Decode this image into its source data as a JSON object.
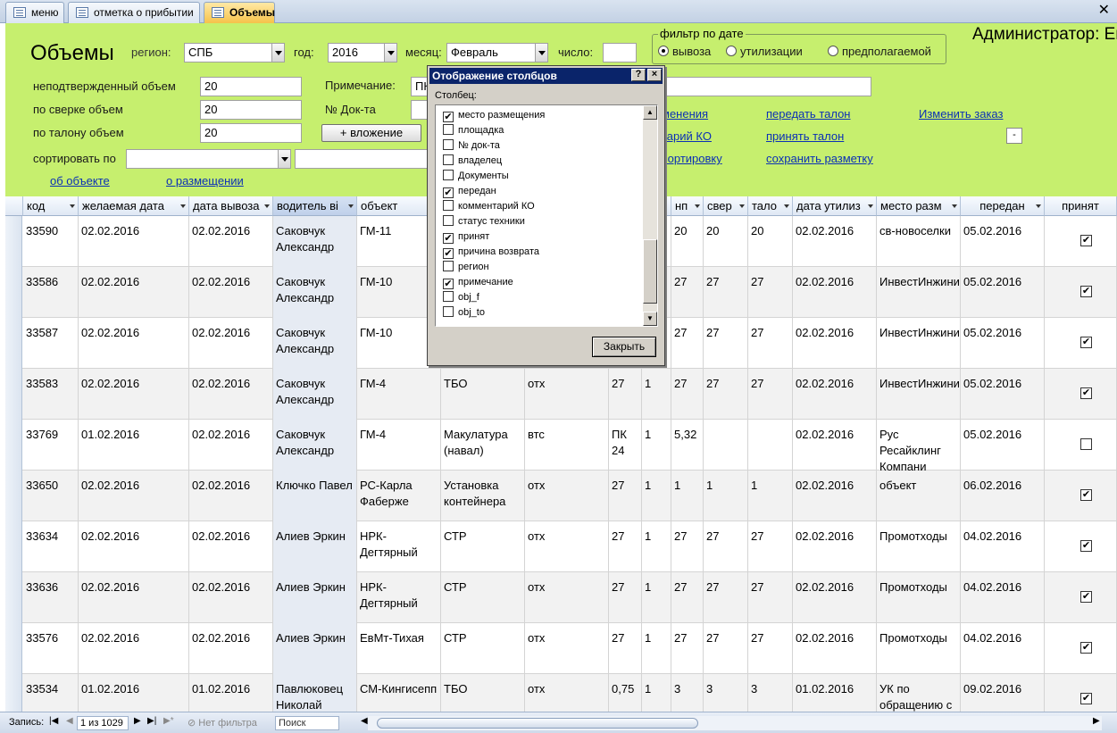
{
  "tabs": [
    {
      "label": "меню"
    },
    {
      "label": "отметка о прибытии"
    },
    {
      "label": "Объемы"
    }
  ],
  "header": {
    "title": "Объемы",
    "region_label": "регион:",
    "region_value": "СПБ",
    "year_label": "год:",
    "year_value": "2016",
    "month_label": "месяц:",
    "month_value": "Февраль",
    "day_label": "число:",
    "day_value": "",
    "admin_text": "Администратор: Ек",
    "date_filter": {
      "legend": "фильтр по дате",
      "options": [
        "вывоза",
        "утилизации",
        "предполагаемой"
      ],
      "selected": "вывоза"
    },
    "unconfirmed_label": "неподтвержденный объем",
    "unconfirmed_value": "20",
    "reconciled_label": "по сверке объем",
    "reconciled_value": "20",
    "ticket_label": "по талону объем",
    "ticket_value": "20",
    "note_label": "Примечание:",
    "note_value": "ПК",
    "doc_label": "№ Док-та",
    "doc_value": "",
    "attach_button": "+ вложение",
    "sort_label": "сортировать по",
    "sort_value": "",
    "sort_value2": "",
    "small_button": "-",
    "links": {
      "changes": "менения",
      "comment_ko": "тарий КО",
      "sort": "сортировку",
      "pass_ticket": "передать талон",
      "accept_ticket": "принять талон",
      "save_layout": "сохранить разметку",
      "change_order": "Изменить заказ",
      "about_object": "об объекте",
      "about_placement": "о размещении"
    }
  },
  "grid": {
    "columns": [
      "код",
      "желаемая дата",
      "дата вывоза",
      "водитель ві",
      "объект",
      "",
      "",
      "",
      "",
      "нп",
      "свер",
      "тало",
      "дата утилиз",
      "место разм",
      "передан",
      "принят"
    ],
    "rows": [
      {
        "kod": "33590",
        "want": "02.02.2016",
        "out": "02.02.2016",
        "driver": "Саковчук Александр",
        "obj": "ГМ-11",
        "waste": "",
        "type": "",
        "c1": "",
        "c2": "",
        "np": "20",
        "sver": "20",
        "talon": "20",
        "util": "02.02.2016",
        "place": "св-новоселки",
        "passed": "05.02.2016",
        "accepted": true
      },
      {
        "kod": "33586",
        "want": "02.02.2016",
        "out": "02.02.2016",
        "driver": "Саковчук Александр",
        "obj": "ГМ-10",
        "waste": "",
        "type": "",
        "c1": "",
        "c2": "",
        "np": "27",
        "sver": "27",
        "talon": "27",
        "util": "02.02.2016",
        "place": "ИнвестИнжиниринг",
        "passed": "05.02.2016",
        "accepted": true
      },
      {
        "kod": "33587",
        "want": "02.02.2016",
        "out": "02.02.2016",
        "driver": "Саковчук Александр",
        "obj": "ГМ-10",
        "waste": "",
        "type": "",
        "c1": "",
        "c2": "",
        "np": "27",
        "sver": "27",
        "talon": "27",
        "util": "02.02.2016",
        "place": "ИнвестИнжиниринг",
        "passed": "05.02.2016",
        "accepted": true
      },
      {
        "kod": "33583",
        "want": "02.02.2016",
        "out": "02.02.2016",
        "driver": "Саковчук Александр",
        "obj": "ГМ-4",
        "waste": "ТБО",
        "type": "отх",
        "c1": "27",
        "c2": "1",
        "np": "27",
        "sver": "27",
        "talon": "27",
        "util": "02.02.2016",
        "place": "ИнвестИнжиниринг",
        "passed": "05.02.2016",
        "accepted": true
      },
      {
        "kod": "33769",
        "want": "01.02.2016",
        "out": "02.02.2016",
        "driver": "Саковчук Александр",
        "obj": "ГМ-4",
        "waste": "Макулатура (навал)",
        "type": "втс",
        "c1": "ПК 24",
        "c2": "1",
        "np": "5,32",
        "sver": "",
        "talon": "",
        "util": "02.02.2016",
        "place": "Рус Ресайклинг Компани",
        "passed": "05.02.2016",
        "accepted": false
      },
      {
        "kod": "33650",
        "want": "02.02.2016",
        "out": "02.02.2016",
        "driver": "Ключко Павел",
        "obj": "РС-Карла Фаберже",
        "waste": "Установка контейнера",
        "type": "отх",
        "c1": "27",
        "c2": "1",
        "np": "1",
        "sver": "1",
        "talon": "1",
        "util": "02.02.2016",
        "place": "объект",
        "passed": "06.02.2016",
        "accepted": true
      },
      {
        "kod": "33634",
        "want": "02.02.2016",
        "out": "02.02.2016",
        "driver": "Алиев Эркин",
        "obj": "НРК-Дегтярный",
        "waste": "СТР",
        "type": "отх",
        "c1": "27",
        "c2": "1",
        "np": "27",
        "sver": "27",
        "talon": "27",
        "util": "02.02.2016",
        "place": "Промотходы",
        "passed": "04.02.2016",
        "accepted": true
      },
      {
        "kod": "33636",
        "want": "02.02.2016",
        "out": "02.02.2016",
        "driver": "Алиев Эркин",
        "obj": "НРК-Дегтярный",
        "waste": "СТР",
        "type": "отх",
        "c1": "27",
        "c2": "1",
        "np": "27",
        "sver": "27",
        "talon": "27",
        "util": "02.02.2016",
        "place": "Промотходы",
        "passed": "04.02.2016",
        "accepted": true
      },
      {
        "kod": "33576",
        "want": "02.02.2016",
        "out": "02.02.2016",
        "driver": "Алиев Эркин",
        "obj": "ЕвМт-Тихая",
        "waste": "СТР",
        "type": "отх",
        "c1": "27",
        "c2": "1",
        "np": "27",
        "sver": "27",
        "talon": "27",
        "util": "02.02.2016",
        "place": "Промотходы",
        "passed": "04.02.2016",
        "accepted": true
      },
      {
        "kod": "33534",
        "want": "01.02.2016",
        "out": "01.02.2016",
        "driver": "Павлюковец Николай",
        "obj": "СМ-Кингисепп",
        "waste": "ТБО",
        "type": "отх",
        "c1": "0,75",
        "c2": "1",
        "np": "3",
        "sver": "3",
        "talon": "3",
        "util": "01.02.2016",
        "place": "УК по обращению с",
        "passed": "09.02.2016",
        "accepted": true
      }
    ]
  },
  "status": {
    "record_label": "Запись:",
    "record_value": "1 из 1029",
    "filter_label": "Нет фильтра",
    "search_placeholder": "Поиск"
  },
  "dialog": {
    "title": "Отображение столбцов",
    "help_btn": "?",
    "close_btn": "×",
    "list_label": "Столбец:",
    "items": [
      {
        "label": "место размещения",
        "checked": true
      },
      {
        "label": "площадка",
        "checked": false
      },
      {
        "label": "№ док-та",
        "checked": false
      },
      {
        "label": "владелец",
        "checked": false
      },
      {
        "label": "Документы",
        "checked": false
      },
      {
        "label": "передан",
        "checked": true
      },
      {
        "label": "комментарий КО",
        "checked": false
      },
      {
        "label": "статус техники",
        "checked": false
      },
      {
        "label": "принят",
        "checked": true
      },
      {
        "label": "причина возврата",
        "checked": true
      },
      {
        "label": "регион",
        "checked": false
      },
      {
        "label": "примечание",
        "checked": true
      },
      {
        "label": "obj_f",
        "checked": false
      },
      {
        "label": "obj_to",
        "checked": false
      }
    ],
    "close_button": "Закрыть"
  }
}
